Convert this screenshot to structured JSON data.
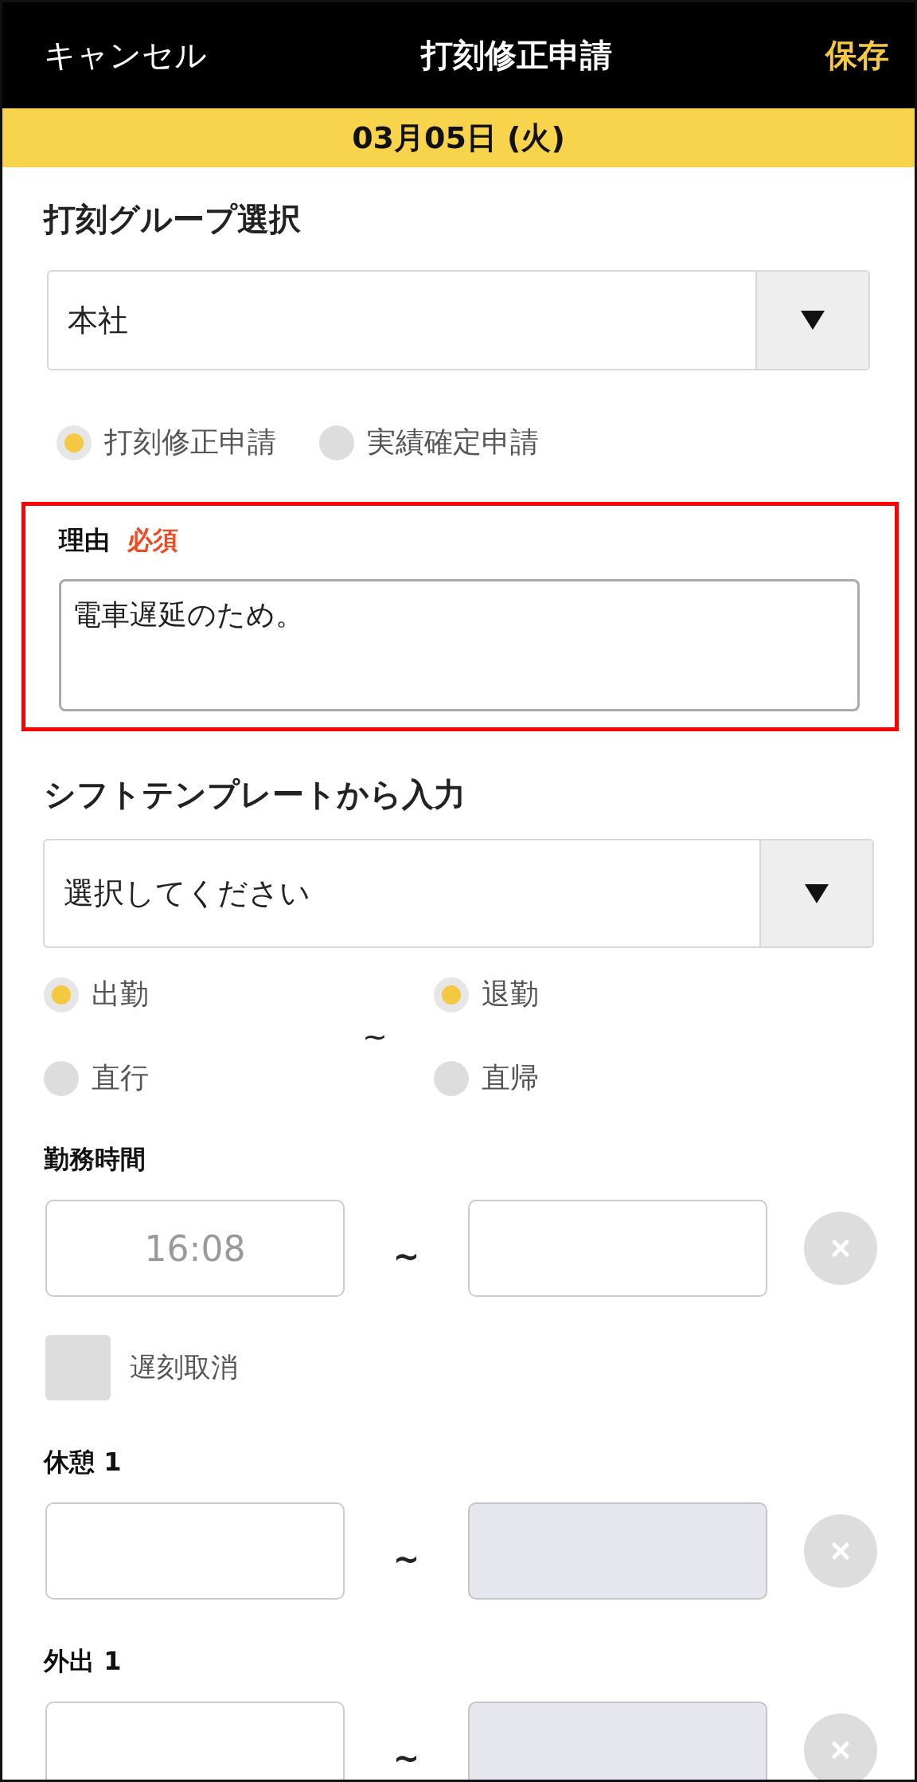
{
  "header": {
    "cancel": "キャンセル",
    "title": "打刻修正申請",
    "save": "保存"
  },
  "date": "03月05日 (火)",
  "group": {
    "title": "打刻グループ選択",
    "value": "本社"
  },
  "request_types": [
    {
      "label": "打刻修正申請",
      "selected": true
    },
    {
      "label": "実績確定申請",
      "selected": false
    }
  ],
  "reason": {
    "label": "理由",
    "required": "必須",
    "value": "電車遅延のため。",
    "highlighted": true
  },
  "template": {
    "title": "シフトテンプレートから入力",
    "placeholder": "選択してください"
  },
  "punch_start": [
    {
      "label": "出勤",
      "selected": true
    },
    {
      "label": "直行",
      "selected": false
    }
  ],
  "punch_tilde": "~",
  "punch_end": [
    {
      "label": "退勤",
      "selected": true
    },
    {
      "label": "直帰",
      "selected": false
    }
  ],
  "time_rows": [
    {
      "label": "勤務時間",
      "start": {
        "placeholder": "16:08",
        "disabled": false
      },
      "tilde": "~",
      "end": {
        "disabled": false
      },
      "late_cancel": {
        "label": "遅刻取消",
        "checked": false
      }
    },
    {
      "label": "休憩 1",
      "start": {
        "disabled": false
      },
      "tilde": "~",
      "end": {
        "disabled": true
      }
    },
    {
      "label": "外出 1",
      "start": {
        "disabled": false
      },
      "tilde": "~",
      "end": {
        "disabled": true
      }
    }
  ]
}
